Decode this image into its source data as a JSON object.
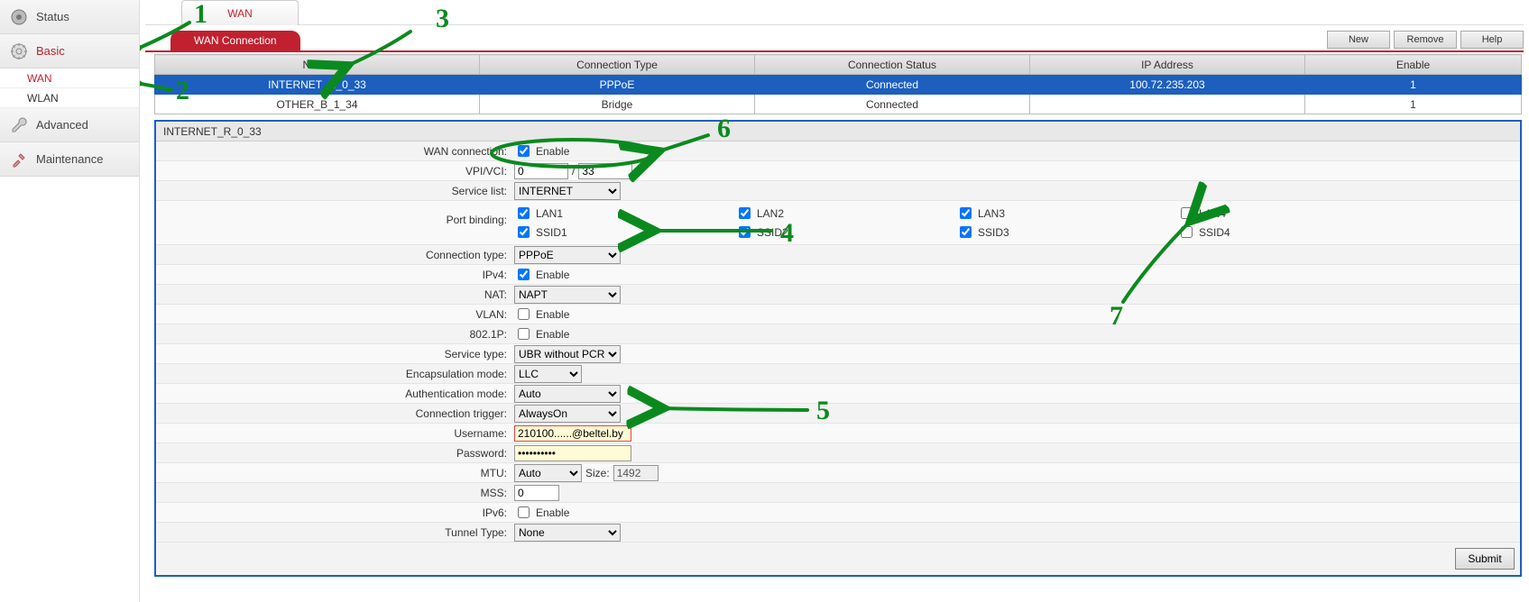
{
  "nav": {
    "status": "Status",
    "basic": "Basic",
    "wan": "WAN",
    "wlan": "WLAN",
    "advanced": "Advanced",
    "maintenance": "Maintenance"
  },
  "top_tab": "WAN",
  "section_title": "WAN Connection",
  "buttons": {
    "new": "New",
    "remove": "Remove",
    "help": "Help",
    "submit": "Submit"
  },
  "table": {
    "headers": {
      "name": "Name",
      "conn_type": "Connection Type",
      "status": "Connection Status",
      "ip": "IP Address",
      "enable": "Enable"
    },
    "rows": [
      {
        "name": "INTERNET_R_0_33",
        "conn_type": "PPPoE",
        "status": "Connected",
        "ip": "100.72.235.203",
        "enable": "1"
      },
      {
        "name": "OTHER_B_1_34",
        "conn_type": "Bridge",
        "status": "Connected",
        "ip": "",
        "enable": "1"
      }
    ]
  },
  "details": {
    "title": "INTERNET_R_0_33",
    "labels": {
      "wan_conn": "WAN connection:",
      "vpi_vci": "VPI/VCI:",
      "sep": "/",
      "service_list": "Service list:",
      "port_binding": "Port binding:",
      "conn_type": "Connection type:",
      "ipv4": "IPv4:",
      "nat": "NAT:",
      "vlan": "VLAN:",
      "p8021": "802.1P:",
      "service_type": "Service type:",
      "encap": "Encapsulation mode:",
      "auth": "Authentication mode:",
      "trigger": "Connection trigger:",
      "username": "Username:",
      "password": "Password:",
      "mtu": "MTU:",
      "mtu_size": "Size:",
      "mss": "MSS:",
      "ipv6": "IPv6:",
      "tunnel": "Tunnel Type:",
      "enable": "Enable"
    },
    "values": {
      "wan_conn_enable": true,
      "vpi": "0",
      "vci": "33",
      "service_list": "INTERNET",
      "conn_type": "PPPoE",
      "ipv4_enable": true,
      "nat": "NAPT",
      "vlan_enable": false,
      "p8021_enable": false,
      "service_type": "UBR without PCR",
      "encap": "LLC",
      "auth": "Auto",
      "trigger": "AlwaysOn",
      "username": "210100......@beltel.by",
      "password": "••••••••••",
      "mtu_mode": "Auto",
      "mtu_size": "1492",
      "mss": "0",
      "ipv6_enable": false,
      "tunnel": "None"
    },
    "ports": {
      "lan1": "LAN1",
      "lan2": "LAN2",
      "lan3": "LAN3",
      "lan4": "LAN4",
      "ssid1": "SSID1",
      "ssid2": "SSID2",
      "ssid3": "SSID3",
      "ssid4": "SSID4",
      "check": {
        "lan1": true,
        "lan2": true,
        "lan3": true,
        "lan4": false,
        "ssid1": true,
        "ssid2": true,
        "ssid3": true,
        "ssid4": false
      }
    }
  },
  "anno": {
    "n1": "1",
    "n2": "2",
    "n3": "3",
    "n4": "4",
    "n5": "5",
    "n6": "6",
    "n7": "7"
  }
}
